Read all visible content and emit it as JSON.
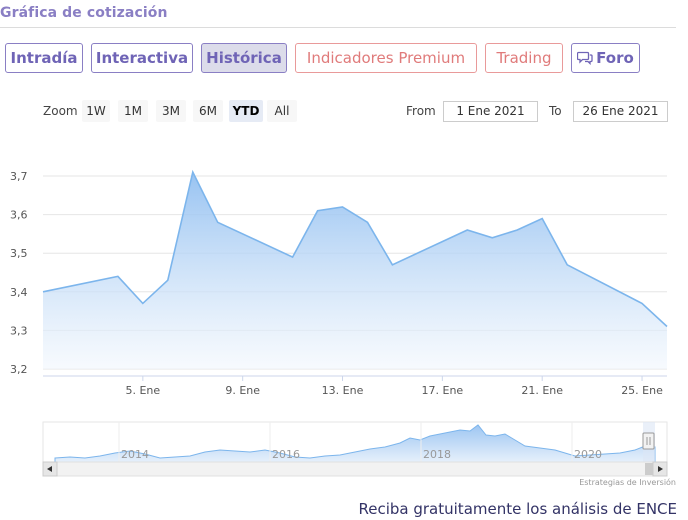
{
  "header": {
    "title": "Gráfica de cotización"
  },
  "tabs": [
    {
      "label": "Intradía",
      "style": "normal"
    },
    {
      "label": "Interactiva",
      "style": "normal"
    },
    {
      "label": "Histórica",
      "style": "active"
    },
    {
      "label": "Indicadores Premium",
      "style": "premium"
    },
    {
      "label": "Trading",
      "style": "premium"
    },
    {
      "label": "Foro",
      "style": "foro",
      "icon": "chat-bubbles-icon"
    }
  ],
  "zoom": {
    "label": "Zoom",
    "buttons": [
      "1W",
      "1M",
      "3M",
      "6M",
      "YTD",
      "All"
    ],
    "selected": "YTD"
  },
  "range": {
    "from_label": "From",
    "from_value": "1 Ene 2021",
    "to_label": "To",
    "to_value": "26 Ene 2021"
  },
  "chart_data": {
    "type": "area",
    "x": [
      "2021-01-01",
      "2021-01-04",
      "2021-01-05",
      "2021-01-06",
      "2021-01-07",
      "2021-01-08",
      "2021-01-11",
      "2021-01-12",
      "2021-01-13",
      "2021-01-14",
      "2021-01-15",
      "2021-01-18",
      "2021-01-19",
      "2021-01-20",
      "2021-01-21",
      "2021-01-22",
      "2021-01-25",
      "2021-01-26"
    ],
    "values": [
      3.4,
      3.44,
      3.37,
      3.43,
      3.71,
      3.58,
      3.49,
      3.61,
      3.62,
      3.58,
      3.47,
      3.56,
      3.54,
      3.56,
      3.59,
      3.47,
      3.37,
      3.31
    ],
    "y_ticks": [
      "3,2",
      "3,3",
      "3,4",
      "3,5",
      "3,6",
      "3,7"
    ],
    "ylim": [
      3.2,
      3.7
    ],
    "x_ticks": [
      "5. Ene",
      "9. Ene",
      "13. Ene",
      "17. Ene",
      "21. Ene",
      "25. Ene"
    ],
    "grid": true,
    "line_color": "#7cb5ec",
    "fill_color_top": "#8cbcf0",
    "fill_color_bottom": "#f2f7fd",
    "navigator": {
      "labels": [
        "2014",
        "2016",
        "2018",
        "2020"
      ]
    }
  },
  "footer": {
    "credit": "Estrategias de Inversión",
    "promo": "Reciba gratuitamente los análisis de ENCE"
  }
}
